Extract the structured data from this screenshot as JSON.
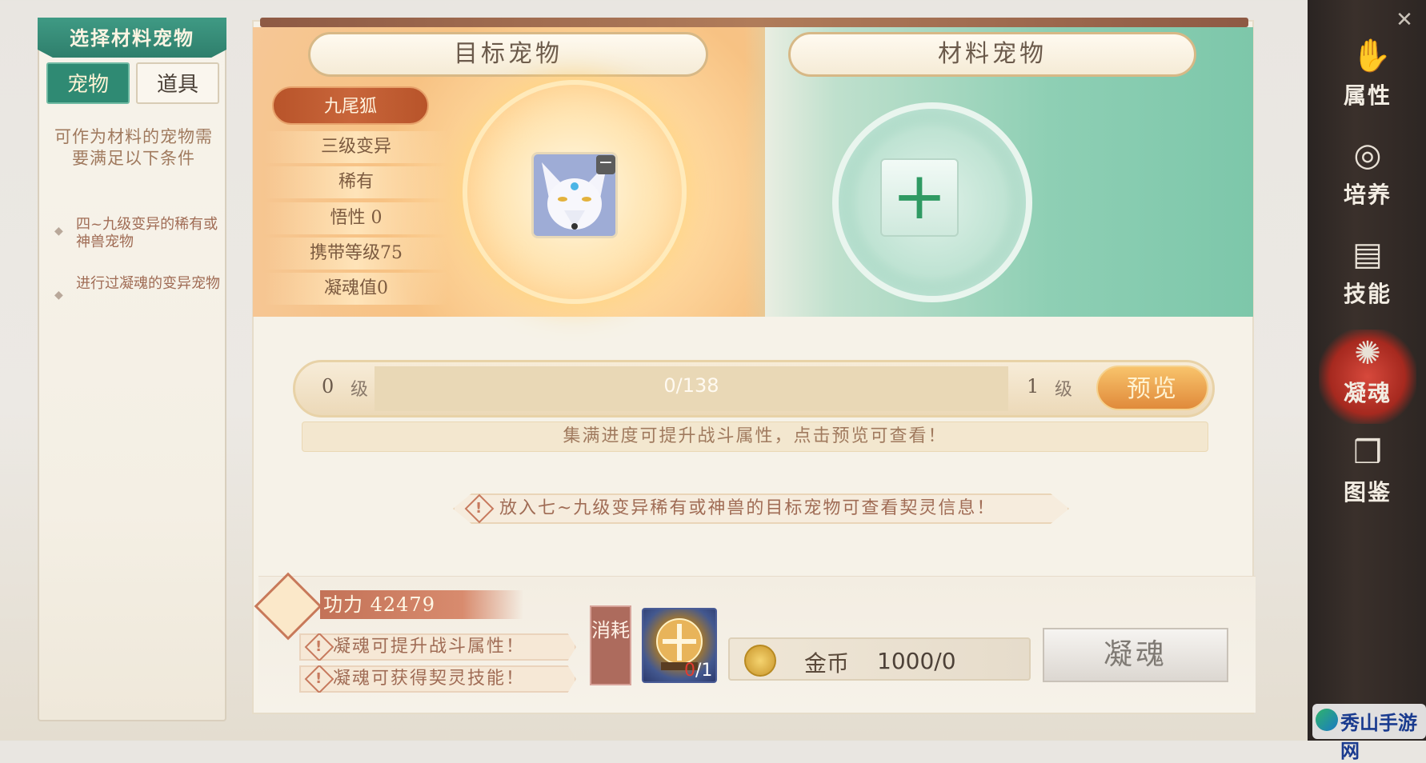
{
  "left_panel": {
    "title": "选择材料宠物",
    "tabs": [
      "宠物",
      "道具"
    ],
    "requirement_title": "可作为材料的宠物需要满足以下条件",
    "requirements": [
      "四~九级变异的稀有或神兽宠物",
      "进行过凝魂的变异宠物"
    ]
  },
  "headers": {
    "target": "目标宠物",
    "material": "材料宠物"
  },
  "target_pet": {
    "name": "九尾狐",
    "attributes": [
      "三级变异",
      "稀有",
      "悟性 0",
      "携带等级75",
      "凝魂值0"
    ],
    "remove_icon": "minus-icon"
  },
  "material_slot": {
    "add_icon": "plus-icon"
  },
  "progress": {
    "current_level": "0",
    "level_unit": "级",
    "text": "0/138",
    "fraction": 0.0,
    "next_level": "1",
    "preview_label": "预览",
    "hint": "集满进度可提升战斗属性，点击预览可查看！"
  },
  "info_banner": "放入七~九级变异稀有或神兽的目标宠物可查看契灵信息！",
  "bottom": {
    "power_label": "功力 42479",
    "bonuses": [
      "凝魂可提升战斗属性！",
      "凝魂可获得契灵技能！"
    ],
    "cost_label": "消耗",
    "cost_item_have": "0",
    "cost_item_need": "/1",
    "coin_label": "金币",
    "coin_value": "1000/0",
    "soul_button": "凝魂"
  },
  "right_nav": [
    {
      "label": "属性",
      "icon": "claw-icon"
    },
    {
      "label": "培养",
      "icon": "bell-icon"
    },
    {
      "label": "技能",
      "icon": "scroll-icon"
    },
    {
      "label": "凝魂",
      "icon": "soul-icon"
    },
    {
      "label": "图鉴",
      "icon": "book-icon"
    }
  ],
  "watermark": "秀山手游网",
  "colors": {
    "accent_teal": "#2f8a73",
    "accent_orange": "#e08a3b",
    "pet_name_bg": "#b8542a",
    "nav_active": "#a6291f"
  }
}
